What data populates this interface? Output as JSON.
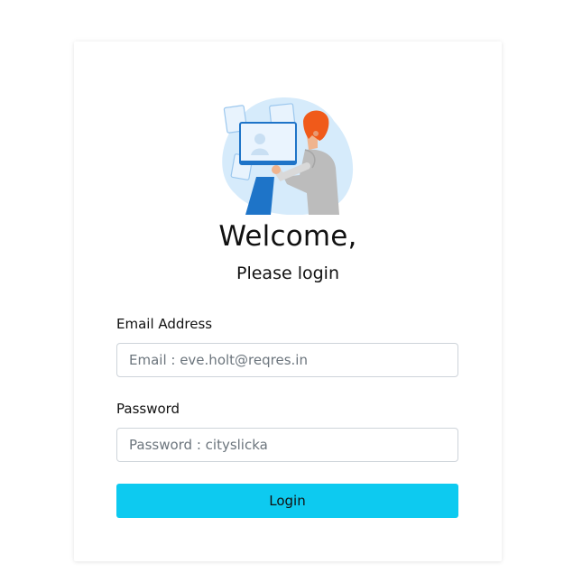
{
  "login": {
    "title": "Welcome,",
    "subtitle": "Please login",
    "email_label": "Email Address",
    "email_placeholder": "Email : eve.holt@reqres.in",
    "email_value": "",
    "password_label": "Password",
    "password_placeholder": "Password : cityslicka",
    "password_value": "",
    "button_label": "Login"
  },
  "illustration": {
    "icon": "person-at-screens-illustration"
  },
  "colors": {
    "button": "#0dcaf0",
    "input_border": "#ced4da",
    "illustration_blob": "#d6ebfb",
    "hair": "#f05a1a",
    "screen_blue": "#1e74c8"
  }
}
